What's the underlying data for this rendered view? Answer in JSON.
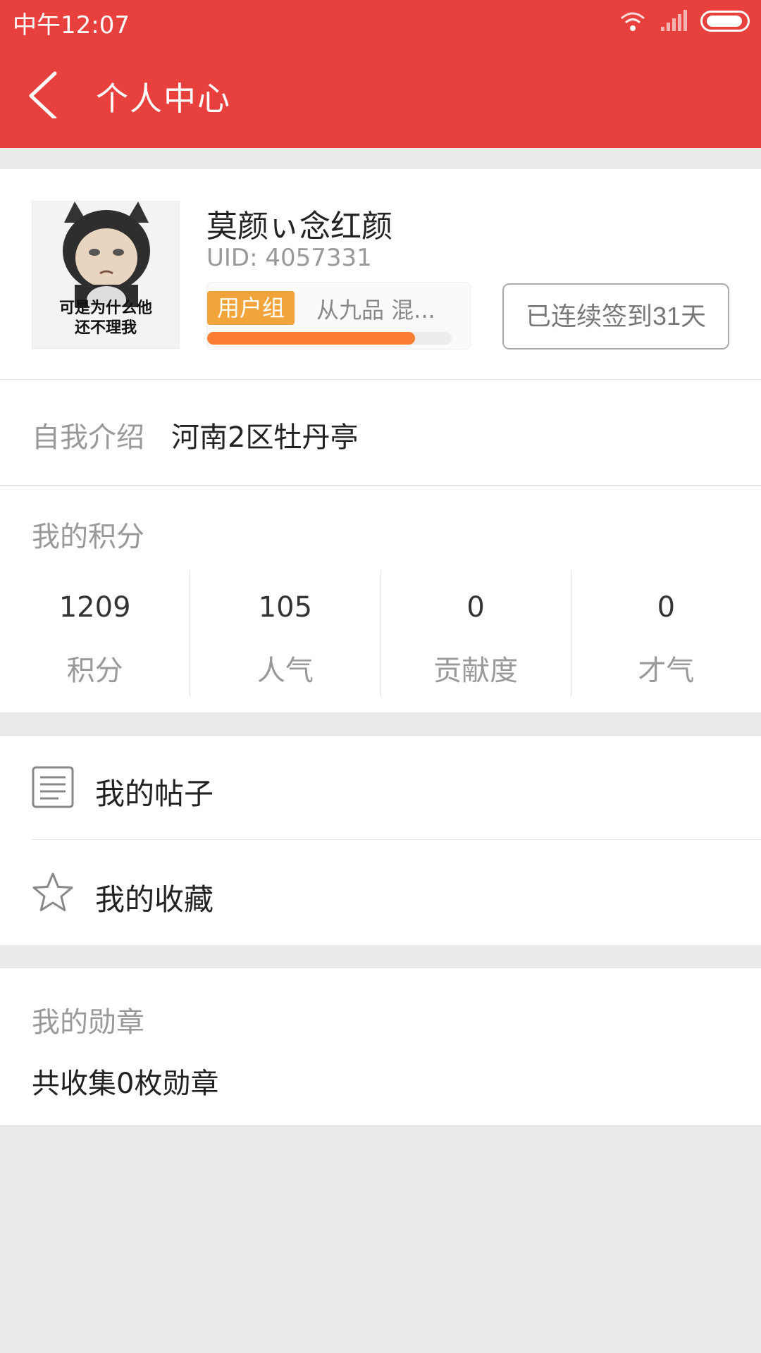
{
  "status_bar": {
    "time": "中午12:07"
  },
  "header": {
    "title": "个人中心"
  },
  "profile": {
    "username": "莫颜ぃ念红颜",
    "uid": "UID: 4057331",
    "avatar_caption_line1": "可是为什么他",
    "avatar_caption_line2": "还不理我",
    "group_badge": "用户组",
    "group_level": "从九品  混...",
    "progress_percent": 85,
    "checkin_label": "已连续签到31天"
  },
  "intro": {
    "label": "自我介绍",
    "value": "河南2区牡丹亭"
  },
  "points": {
    "title": "我的积分",
    "stats": [
      {
        "value": "1209",
        "label": "积分"
      },
      {
        "value": "105",
        "label": "人气"
      },
      {
        "value": "0",
        "label": "贡献度"
      },
      {
        "value": "0",
        "label": "才气"
      }
    ]
  },
  "menu": {
    "items": [
      {
        "label": "我的帖子",
        "icon": "document-icon"
      },
      {
        "label": "我的收藏",
        "icon": "star-icon"
      }
    ]
  },
  "medals": {
    "title": "我的勋章",
    "count_text": "共收集0枚勋章"
  },
  "colors": {
    "brand_red": "#e8413d",
    "badge_orange": "#f0a43a",
    "progress_orange": "#fa7d31"
  }
}
